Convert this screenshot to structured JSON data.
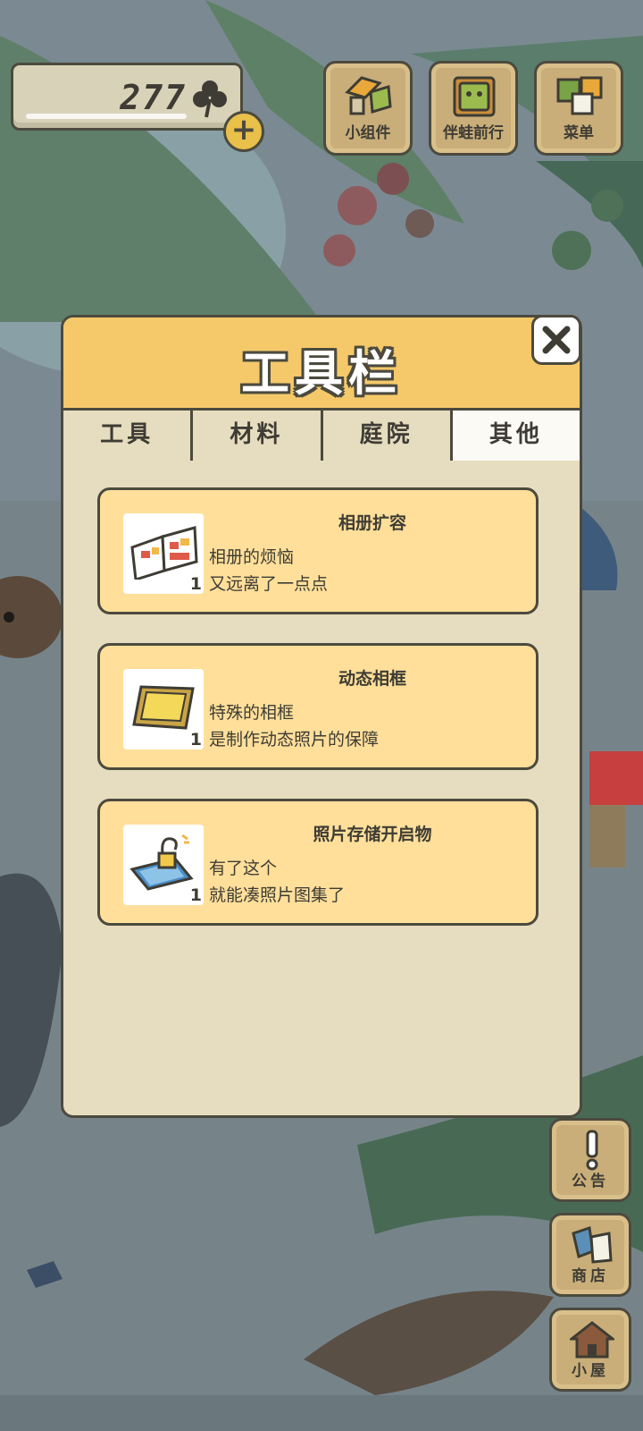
{
  "hud": {
    "clover_count": "277",
    "clover_icon": "clover-icon",
    "plus_label": "+",
    "buttons": [
      {
        "label": "小组件",
        "icon": "widget-icon"
      },
      {
        "label": "伴蛙前行",
        "icon": "frog-journey-icon"
      },
      {
        "label": "菜单",
        "icon": "menu-icon"
      }
    ]
  },
  "dialog": {
    "title": "工具栏",
    "close_icon": "close-icon",
    "tabs": [
      {
        "label": "工具",
        "active": false
      },
      {
        "label": "材料",
        "active": false
      },
      {
        "label": "庭院",
        "active": false
      },
      {
        "label": "其他",
        "active": true
      }
    ],
    "items": [
      {
        "name": "相册扩容",
        "desc1": "相册的烦恼",
        "desc2": "又远离了一点点",
        "qty": "1",
        "icon": "album-icon"
      },
      {
        "name": "动态相框",
        "desc1": "特殊的相框",
        "desc2": "是制作动态照片的保障",
        "qty": "1",
        "icon": "frame-icon"
      },
      {
        "name": "照片存储开启物",
        "desc1": "有了这个",
        "desc2": "就能凑照片图集了",
        "qty": "1",
        "icon": "unlock-icon"
      }
    ]
  },
  "side": {
    "buttons": [
      {
        "label": "公告",
        "icon": "notice-icon"
      },
      {
        "label": "商店",
        "icon": "shop-icon"
      },
      {
        "label": "小屋",
        "icon": "house-icon"
      }
    ]
  },
  "colors": {
    "header": "#f5c96a",
    "panel": "#e6dcbf",
    "card": "#ffdf9a",
    "outline": "#4c4a3e"
  }
}
